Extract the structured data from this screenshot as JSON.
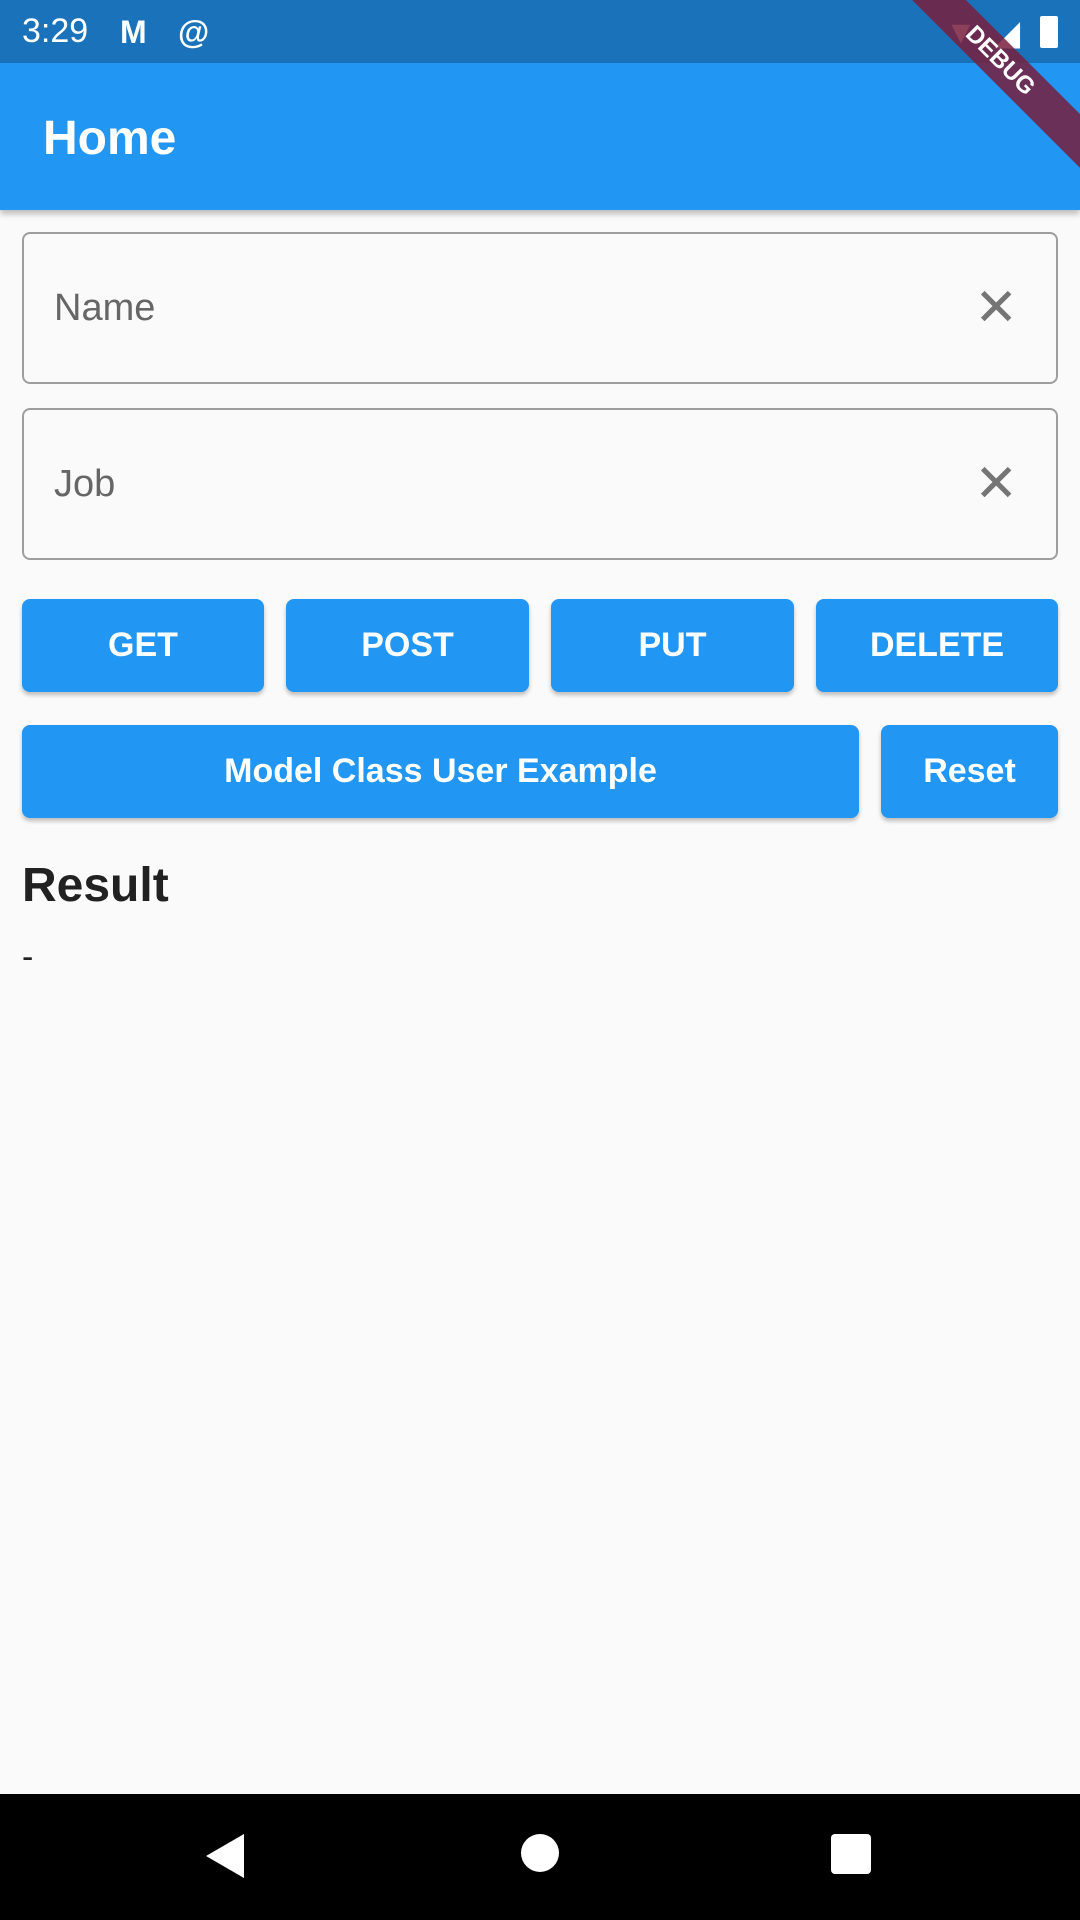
{
  "status_bar": {
    "time": "3:29",
    "notif_icons": [
      "gmail-icon",
      "app-notification-icon"
    ],
    "system_icons": [
      "wifi-icon",
      "signal-icon",
      "battery-icon"
    ]
  },
  "debug_banner": "DEBUG",
  "app_bar": {
    "title": "Home"
  },
  "fields": [
    {
      "placeholder": "Name",
      "value": ""
    },
    {
      "placeholder": "Job",
      "value": ""
    }
  ],
  "buttons": {
    "get": "GET",
    "post": "POST",
    "put": "PUT",
    "delete": "DELETE",
    "model": "Model Class User Example",
    "reset": "Reset"
  },
  "result": {
    "heading": "Result",
    "value": "-"
  },
  "colors": {
    "primary": "#2196f3",
    "status_bar": "#1a73ba"
  }
}
